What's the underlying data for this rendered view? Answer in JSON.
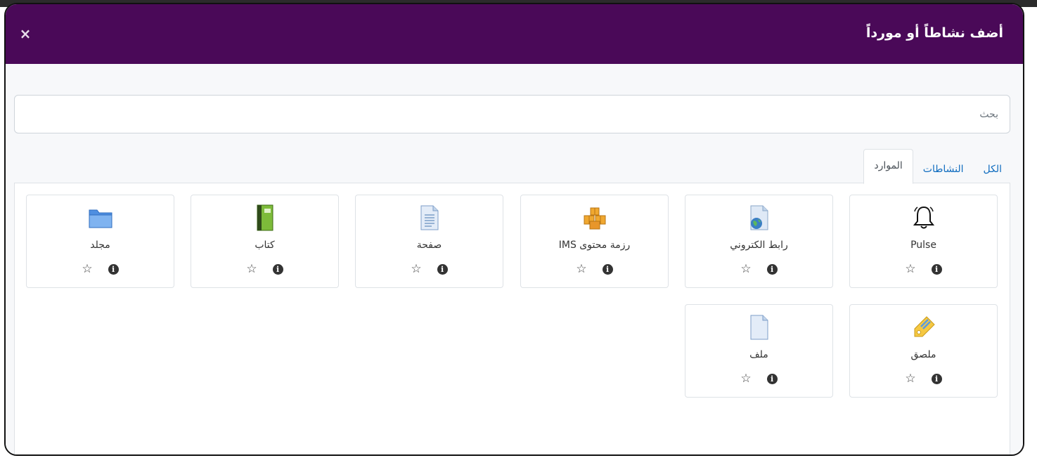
{
  "modal": {
    "title": "أضف نشاطاً أو مورداً",
    "close_glyph": "×"
  },
  "search": {
    "placeholder": "بحث",
    "value": ""
  },
  "tabs": [
    {
      "label": "الكل"
    },
    {
      "label": "النشاطات"
    },
    {
      "label": "الموارد",
      "active": true
    }
  ],
  "items": [
    {
      "label": "Pulse",
      "icon": "bell-icon"
    },
    {
      "label": "رابط الكتروني",
      "icon": "url-globe-icon"
    },
    {
      "label": "رزمة محتوى IMS",
      "icon": "ims-package-icon"
    },
    {
      "label": "صفحة",
      "icon": "page-document-icon"
    },
    {
      "label": "كتاب",
      "icon": "book-icon"
    },
    {
      "label": "مجلد",
      "icon": "folder-icon"
    },
    {
      "label": "ملصق",
      "icon": "label-tag-icon"
    },
    {
      "label": "ملف",
      "icon": "file-icon"
    }
  ],
  "actions": {
    "info_glyph": "i",
    "star_glyph": "☆"
  },
  "colors": {
    "header": "#4a0958",
    "link": "#0f6cbf"
  }
}
